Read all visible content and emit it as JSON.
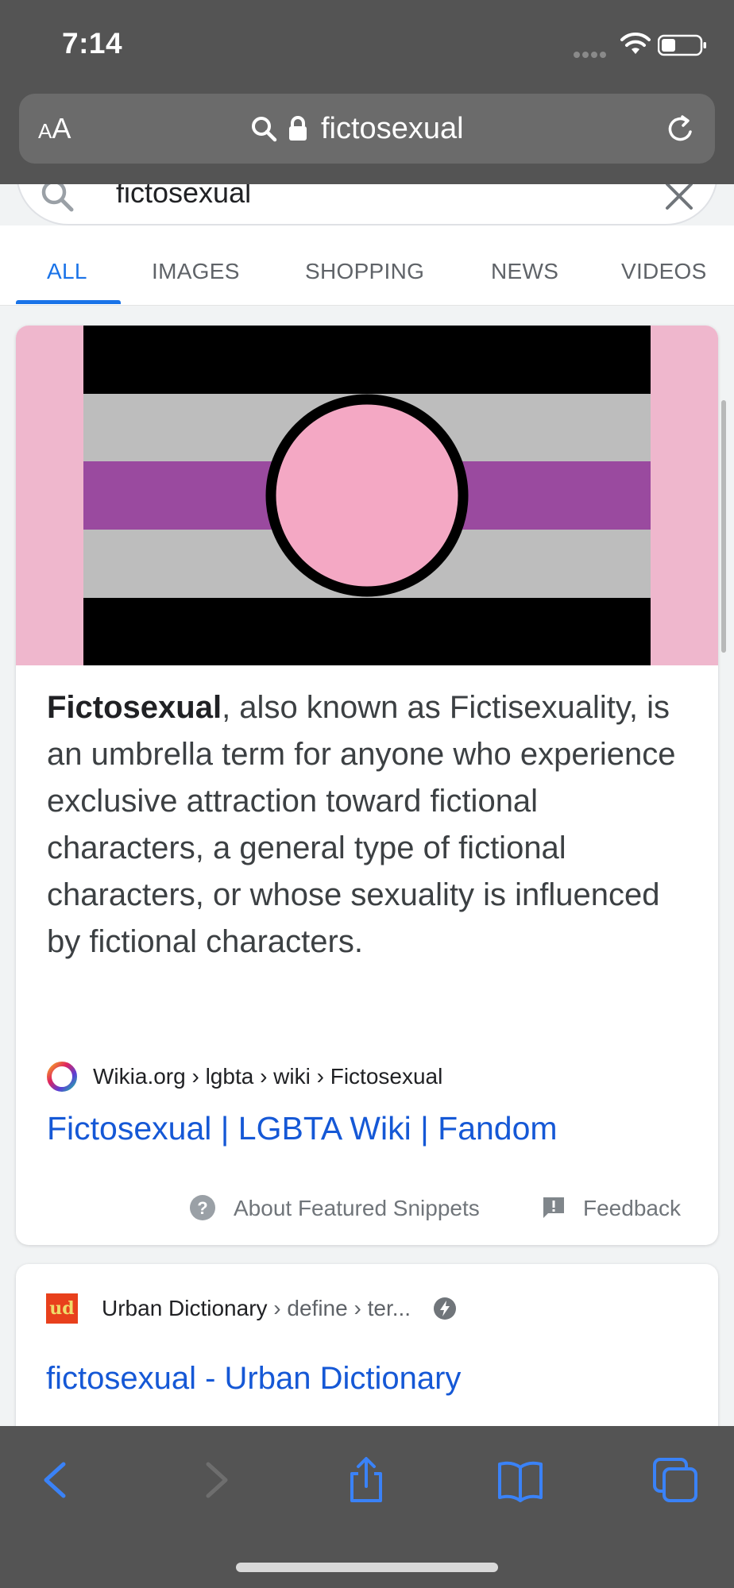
{
  "status_bar": {
    "time": "7:14"
  },
  "browser": {
    "aa_label_small": "A",
    "aa_label_large": "A",
    "url": "fictosexual"
  },
  "search": {
    "query": "fictosexual"
  },
  "tabs": [
    {
      "label": "ALL",
      "active": true
    },
    {
      "label": "IMAGES",
      "active": false
    },
    {
      "label": "SHOPPING",
      "active": false
    },
    {
      "label": "NEWS",
      "active": false
    },
    {
      "label": "VIDEOS",
      "active": false
    }
  ],
  "featured_snippet": {
    "term": "Fictosexual",
    "text": ", also known as Fictisexuality, is an umbrella term for anyone who experience exclusive attraction toward fictional characters, a general type of fictional characters, or whose sexuality is influenced by fictional characters.",
    "source": "Wikia.org › lgbta › wiki › Fictosexual",
    "link_title": "Fictosexual | LGBTA Wiki | Fandom",
    "about_label": "About Featured Snippets",
    "feedback_label": "Feedback",
    "flag_colors": {
      "background": "#efb7cd",
      "stripe_black": "#000000",
      "stripe_gray": "#bdbdbd",
      "stripe_purple": "#9a4a9f",
      "circle_pink": "#f4a8c4"
    }
  },
  "second_result": {
    "logo_text": "ud",
    "site": "Urban Dictionary",
    "path": " › define › ter...",
    "link_title": "fictosexual - Urban Dictionary"
  },
  "colors": {
    "chrome_gray": "#545454",
    "link_blue": "#1558d6",
    "tab_blue": "#1a73e8",
    "toolbar_icon_blue": "#3a82f7"
  },
  "toolbar_icons": [
    "back-icon",
    "forward-icon",
    "share-icon",
    "bookmarks-icon",
    "tabs-icon"
  ]
}
